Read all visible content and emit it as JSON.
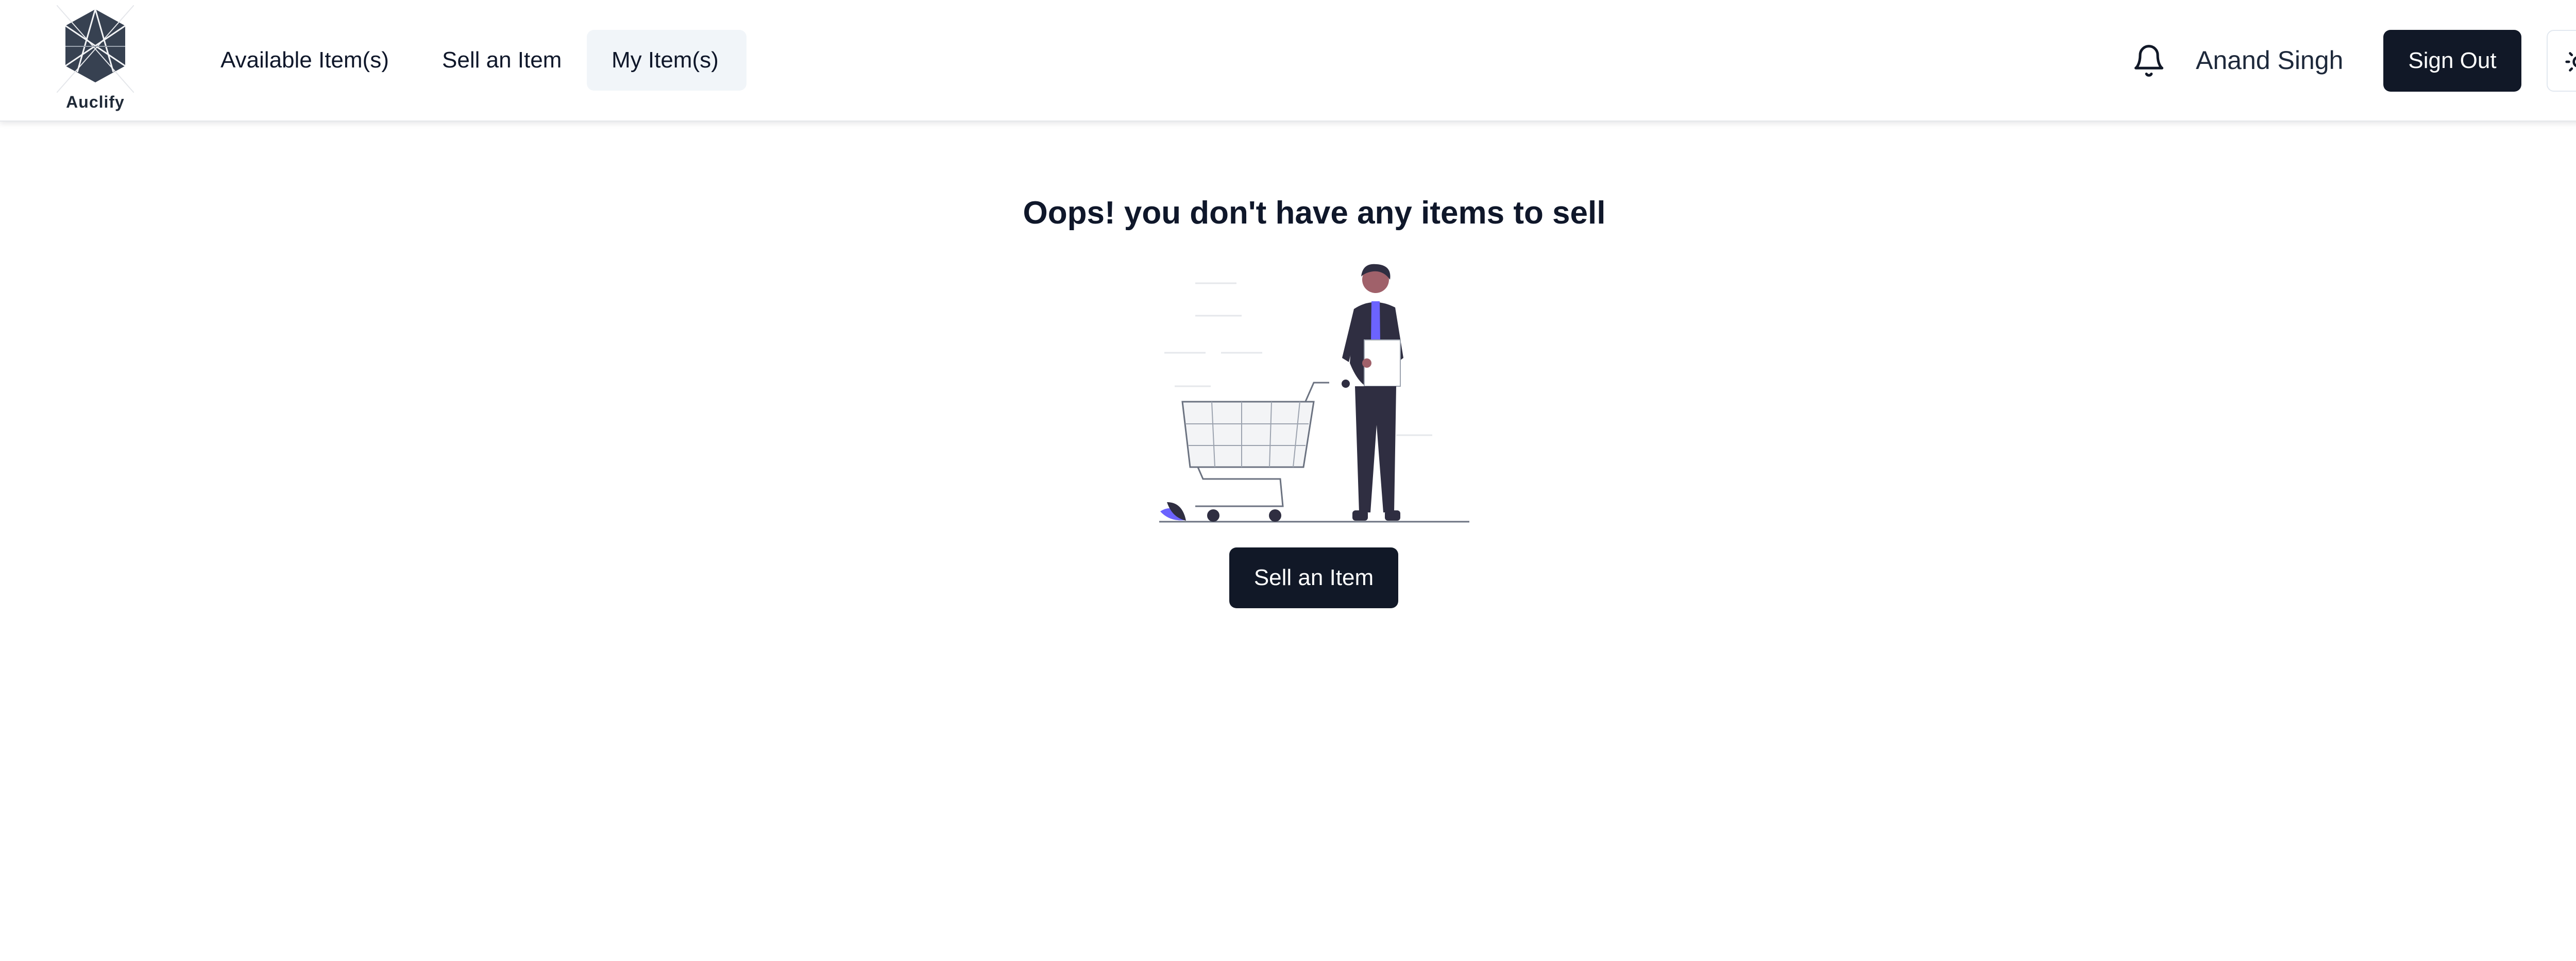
{
  "header": {
    "logo_text": "Auclify",
    "nav": {
      "available": "Available Item(s)",
      "sell": "Sell an Item",
      "my_items": "My Item(s)"
    },
    "user_name": "Anand Singh",
    "sign_out_label": "Sign Out",
    "icons": {
      "notifications": "bell-icon",
      "theme": "sun-icon"
    }
  },
  "main": {
    "empty_title": "Oops! you don't have any items to sell",
    "cta_label": "Sell an Item"
  },
  "colors": {
    "primary": "#111827",
    "nav_active_bg": "#f1f5f9",
    "accent": "#6c63ff"
  }
}
